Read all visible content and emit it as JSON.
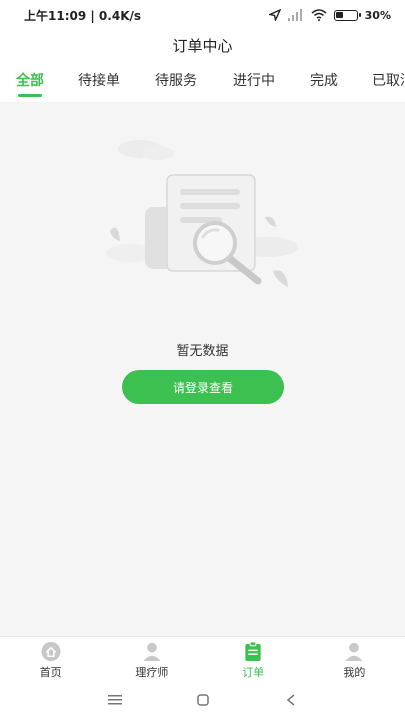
{
  "status_bar": {
    "time_speed": "上午11:09 | 0.4K/s",
    "battery": "30%"
  },
  "header": {
    "title": "订单中心"
  },
  "tabs": [
    {
      "label": "全部",
      "active": true
    },
    {
      "label": "待接单"
    },
    {
      "label": "待服务"
    },
    {
      "label": "进行中"
    },
    {
      "label": "完成"
    },
    {
      "label": "已取消"
    }
  ],
  "empty_state": {
    "message": "暂无数据",
    "button_label": "请登录查看"
  },
  "bottom_nav": [
    {
      "label": "首页",
      "icon": "home-icon"
    },
    {
      "label": "理疗师",
      "icon": "therapist-icon"
    },
    {
      "label": "订单",
      "icon": "order-icon",
      "active": true
    },
    {
      "label": "我的",
      "icon": "profile-icon"
    }
  ],
  "colors": {
    "accent": "#3cc04f",
    "background": "#f5f5f5"
  }
}
